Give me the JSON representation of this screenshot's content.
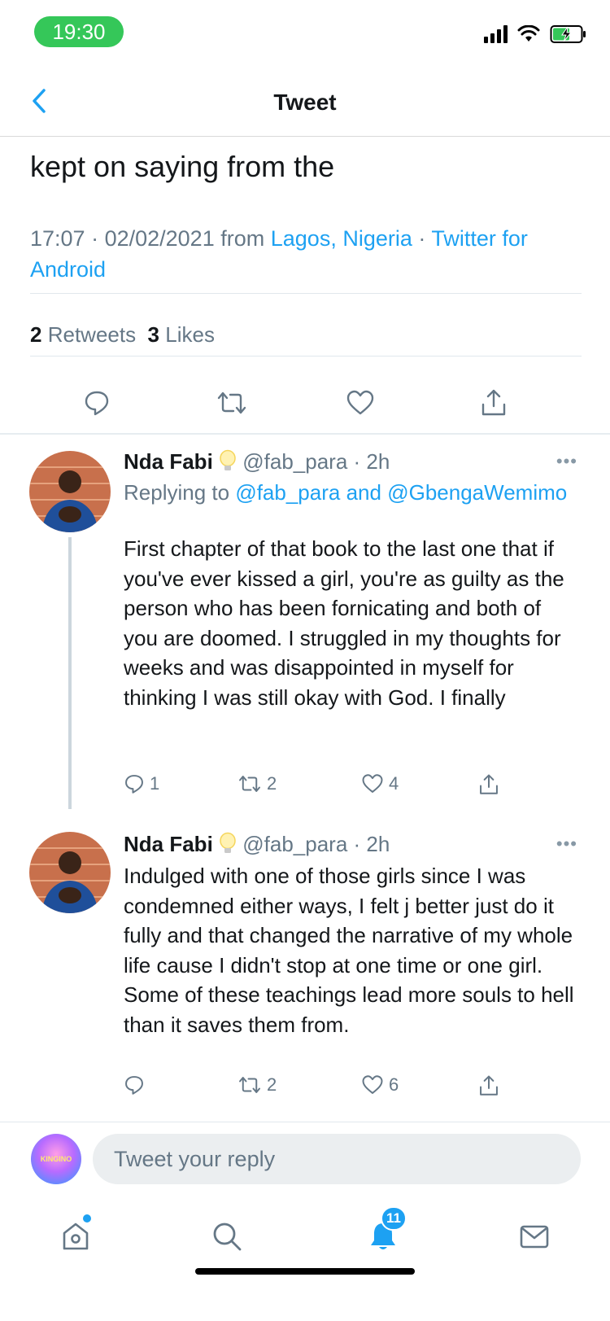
{
  "status_bar": {
    "time": "19:30"
  },
  "header": {
    "title": "Tweet"
  },
  "main_tweet": {
    "text": "kept on saying from the",
    "time": "17:07",
    "date": "02/02/2021",
    "from_word": "from",
    "location": "Lagos, Nigeria",
    "client": "Twitter for Android",
    "retweets_count": "2",
    "retweets_label": "Retweets",
    "likes_count": "3",
    "likes_label": "Likes"
  },
  "replies": [
    {
      "name": "Nda Fabi",
      "handle": "@fab_para",
      "time": "2h",
      "replying_to_label": "Replying to",
      "replying_to_1": "@fab_para",
      "replying_and": "and",
      "replying_to_2": "@GbengaWemimo",
      "text": "First chapter of that book to the last one that if you've ever kissed a girl, you're as guilty as the person who has been fornicating and both of you are doomed. I struggled in my thoughts for weeks and was disappointed in myself for thinking I was still okay with God. I finally",
      "reply_count": "1",
      "retweet_count": "2",
      "like_count": "4"
    },
    {
      "name": "Nda Fabi",
      "handle": "@fab_para",
      "time": "2h",
      "text": "Indulged with one of those girls since I was condemned either ways, I felt j better just do it fully and that changed the narrative of my whole life cause I didn't stop at one time or one girl. Some of these teachings lead more souls to hell than it saves them from.",
      "reply_count": "",
      "retweet_count": "2",
      "like_count": "6"
    }
  ],
  "compose": {
    "placeholder": "Tweet your reply",
    "avatar_text": "KINGINO"
  },
  "tab_bar": {
    "notifications_badge": "11"
  },
  "colors": {
    "accent": "#1da1f2",
    "status_green": "#35c759",
    "secondary_text": "#657786"
  }
}
